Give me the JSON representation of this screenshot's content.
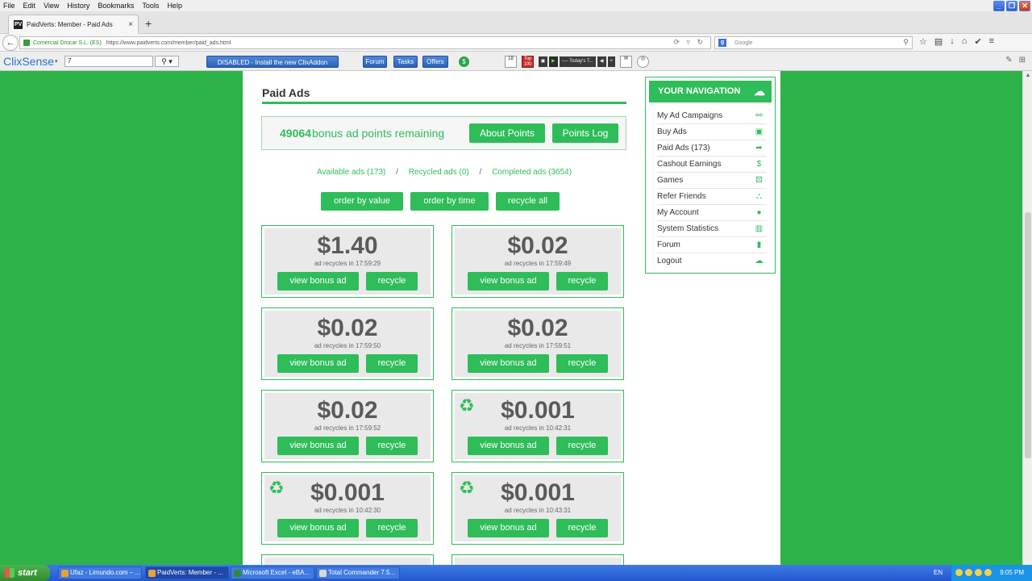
{
  "menu": [
    "File",
    "Edit",
    "View",
    "History",
    "Bookmarks",
    "Tools",
    "Help"
  ],
  "browser": {
    "tab_title": "PaidVerts: Member - Paid Ads",
    "tab_favicon": "PV",
    "url_secure_label": "Comercial Drocar S.L. (ES)",
    "url": "https://www.paidverts.com/member/paid_ads.html",
    "search_placeholder": "Google"
  },
  "toolbar": {
    "logo": "ClixSense",
    "select_value": "7",
    "disabled_label": "DISABLED - Install the new ClixAddon",
    "forum": "Forum",
    "tasks": "Tasks",
    "offers": "Offers",
    "player_label": "---- Today's T...",
    "top100": "Top 100",
    "cal_day": "18"
  },
  "page": {
    "title": "Paid Ads",
    "points_value": "49064",
    "points_text": "bonus ad points remaining",
    "about_points": "About Points",
    "points_log": "Points Log",
    "filters": {
      "available": "Available ads (173)",
      "recycled": "Recycled ads (0)",
      "completed": "Completed ads (3654)",
      "separator": "/"
    },
    "order_by_value": "order by value",
    "order_by_time": "order by time",
    "recycle_all": "recycle all",
    "view_label": "view bonus ad",
    "recycle_label": "recycle",
    "ads": [
      {
        "price": "$1.40",
        "note": "ad recycles in 17:59:29",
        "recycled": false
      },
      {
        "price": "$0.02",
        "note": "ad recycles in 17:59:49",
        "recycled": false
      },
      {
        "price": "$0.02",
        "note": "ad recycles in 17:59:50",
        "recycled": false
      },
      {
        "price": "$0.02",
        "note": "ad recycles in 17:59:51",
        "recycled": false
      },
      {
        "price": "$0.02",
        "note": "ad recycles in 17:59:52",
        "recycled": false
      },
      {
        "price": "$0.001",
        "note": "ad recycles in 10:42:31",
        "recycled": true
      },
      {
        "price": "$0.001",
        "note": "ad recycles in 10:42:30",
        "recycled": true
      },
      {
        "price": "$0.001",
        "note": "ad recycles in 10:43:31",
        "recycled": true
      }
    ]
  },
  "navigation": {
    "title": "YOUR NAVIGATION",
    "items": [
      {
        "label": "My Ad Campaigns",
        "icon": "share-icon"
      },
      {
        "label": "Buy Ads",
        "icon": "money-icon"
      },
      {
        "label": "Paid Ads (173)",
        "icon": "share-arrow-icon"
      },
      {
        "label": "Cashout Earnings",
        "icon": "money-bag-icon"
      },
      {
        "label": "Games",
        "icon": "dice-icon"
      },
      {
        "label": "Refer Friends",
        "icon": "sitemap-icon"
      },
      {
        "label": "My Account",
        "icon": "user-icon"
      },
      {
        "label": "System Statistics",
        "icon": "stats-icon"
      },
      {
        "label": "Forum",
        "icon": "book-icon"
      },
      {
        "label": "Logout",
        "icon": "cloud-upload-icon"
      }
    ]
  },
  "taskbar": {
    "start": "start",
    "items": [
      "Ufaz - Limundo.com – ...",
      "PaidVerts: Member - ...",
      "Microsoft Excel - eBA...",
      "Total Commander 7.5..."
    ],
    "lang": "EN",
    "clock": "9:05 PM"
  },
  "colors": {
    "brand_green": "#2ebd59",
    "background_green": "#2db34a",
    "xp_blue": "#2457cf"
  }
}
